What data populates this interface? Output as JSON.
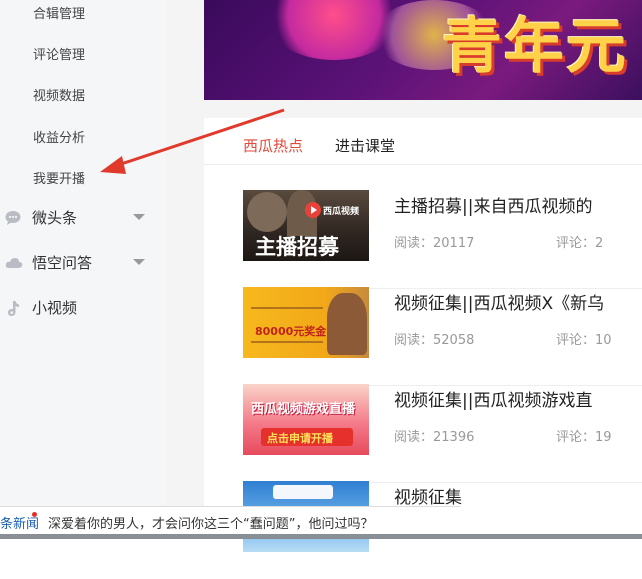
{
  "sidebar": {
    "sub_items": [
      "合辑管理",
      "评论管理",
      "视频数据",
      "收益分析",
      "我要开播"
    ],
    "main_items": [
      {
        "label": "微头条",
        "icon": "chat-bubble-icon",
        "expandable": true
      },
      {
        "label": "悟空问答",
        "icon": "cloud-icon",
        "expandable": true
      },
      {
        "label": "小视频",
        "icon": "tiktok-note-icon",
        "expandable": false
      }
    ]
  },
  "banner": {
    "text": "青年元"
  },
  "tabs": [
    {
      "label": "西瓜热点",
      "active": true
    },
    {
      "label": "进击课堂",
      "active": false
    }
  ],
  "articles": [
    {
      "title": "主播招募||来自西瓜视频的",
      "reads_label": "阅读：",
      "reads": "20117",
      "comments_label": "评论：",
      "comments": "2",
      "thumb_text": "主播招募",
      "thumb_badge": "西瓜视频"
    },
    {
      "title": "视频征集||西瓜视频X《新乌",
      "reads_label": "阅读：",
      "reads": "52058",
      "comments_label": "评论：",
      "comments": "10",
      "thumb_text": "80000元奖金",
      "thumb_badge": ""
    },
    {
      "title": "视频征集||西瓜视频游戏直",
      "reads_label": "阅读：",
      "reads": "21396",
      "comments_label": "评论：",
      "comments": "19",
      "thumb_text": "西瓜视频游戏直播",
      "thumb_badge": "点击申请开播"
    },
    {
      "title": "视频征集",
      "reads_label": "",
      "reads": "",
      "comments_label": "",
      "comments": "",
      "thumb_text": "",
      "thumb_badge": ""
    }
  ],
  "news_ticker": {
    "source": "条新闻",
    "headline": "深爱着你的男人，才会问你这三个“蠢问题”，他问过吗？"
  },
  "colors": {
    "accent": "#e24a3b",
    "arrow": "#e03a2c",
    "sidebar_bg": "#f5f6f8",
    "link": "#1a5fb4"
  }
}
